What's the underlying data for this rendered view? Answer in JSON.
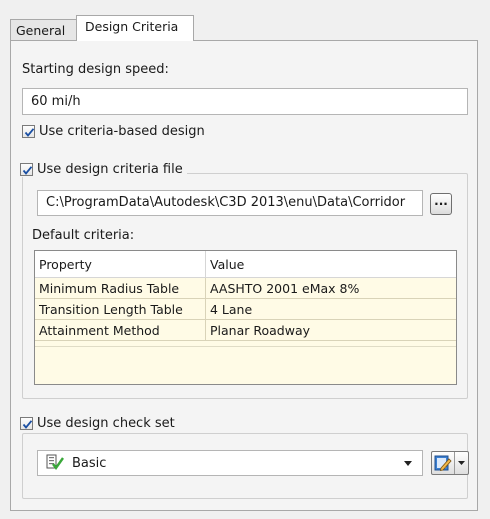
{
  "tabs": [
    {
      "label": "General",
      "active": false
    },
    {
      "label": "Design Criteria",
      "active": true
    }
  ],
  "starting_speed": {
    "label": "Starting design speed:",
    "value": "60 mi/h"
  },
  "criteria_based": {
    "label": "Use criteria-based design",
    "checked": true
  },
  "criteria_file": {
    "label": "Use design criteria file",
    "checked": true,
    "path": "C:\\ProgramData\\Autodesk\\C3D 2013\\enu\\Data\\Corridor",
    "browse_label": "···"
  },
  "default_criteria": {
    "label": "Default criteria:",
    "columns": [
      "Property",
      "Value"
    ],
    "rows": [
      {
        "property": "Minimum Radius Table",
        "value": "AASHTO 2001 eMax 8%"
      },
      {
        "property": "Transition Length Table",
        "value": "4 Lane"
      },
      {
        "property": "Attainment Method",
        "value": "Planar Roadway"
      }
    ]
  },
  "check_set": {
    "label": "Use design check set",
    "checked": true,
    "selected": "Basic",
    "icon": "check-set-icon",
    "edit_icon": "edit-pencil-icon"
  },
  "colors": {
    "grid_row_bg": "#fffbe6",
    "checkmark": "#1a4fa3"
  }
}
